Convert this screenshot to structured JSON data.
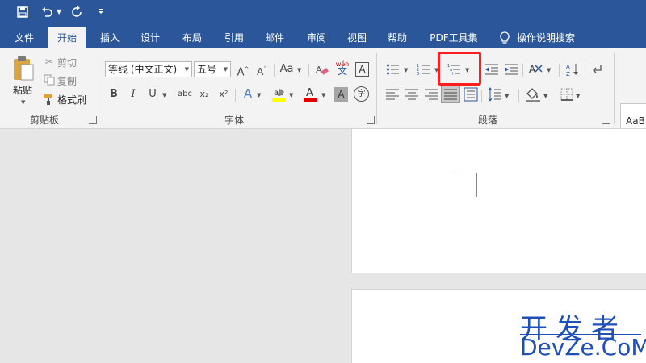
{
  "titlebar": {
    "bg": "#2b579a"
  },
  "qat": {
    "save_icon": "save-icon",
    "undo_icon": "undo-icon",
    "redo_icon": "redo-icon",
    "customize_icon": "customize-qat-icon"
  },
  "tabs": [
    {
      "label": "文件"
    },
    {
      "label": "开始",
      "active": true
    },
    {
      "label": "插入"
    },
    {
      "label": "设计"
    },
    {
      "label": "布局"
    },
    {
      "label": "引用"
    },
    {
      "label": "邮件"
    },
    {
      "label": "审阅"
    },
    {
      "label": "视图"
    },
    {
      "label": "帮助"
    },
    {
      "label": "PDF工具集"
    },
    {
      "label": "操作说明搜索"
    }
  ],
  "clipboard": {
    "paste_label": "粘贴",
    "cut_label": "剪切",
    "copy_label": "复制",
    "format_painter_label": "格式刷",
    "group_label": "剪贴板"
  },
  "font": {
    "font_name": "等线 (中文正文)",
    "font_size": "五号",
    "bold": "B",
    "italic": "I",
    "underline": "U",
    "strike": "abc",
    "subscript": "x₂",
    "superscript": "x²",
    "font_color_glyph": "A",
    "case_glyph": "Aa",
    "pinyin_top": "wén",
    "pinyin_bottom": "文",
    "enclose_glyph": "字",
    "group_label": "字体"
  },
  "paragraph": {
    "group_label": "段落"
  },
  "styles": {
    "preview": "AaB"
  },
  "watermark": {
    "line1": "开发者",
    "line2": "DevZe.CoM"
  },
  "colors": {
    "accent": "#2b579a",
    "highlight_box": "#ff1e1e",
    "font_color_bar": "#e00000",
    "highlight_bar": "#ffff00",
    "watermark": "#1f4fb8"
  }
}
